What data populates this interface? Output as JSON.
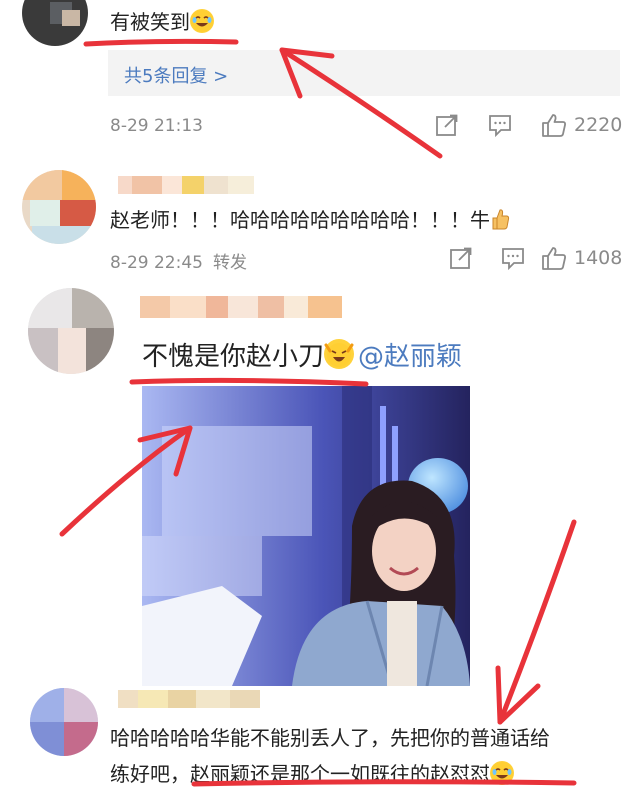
{
  "comment1": {
    "text": "有被笑到",
    "reply_link": "共5条回复 >",
    "time": "8-29 21:13",
    "likes": "2220"
  },
  "comment2": {
    "text": "赵老师！！！哈哈哈哈哈哈哈哈哈！！！牛",
    "time": "8-29 22:45",
    "forward": "转发",
    "likes": "1408"
  },
  "comment3": {
    "text": "不愧是你赵小刀",
    "mention": "@赵丽颖"
  },
  "comment4": {
    "line1": "哈哈哈哈哈华能不能别丢人了，先把你的普通话给",
    "line2_prefix": "练好吧，",
    "line2_underlined": "赵丽颖还是那个一如既往的赵怼怼"
  },
  "colors": {
    "link": "#4c7bbf",
    "annotation": "#e8333a",
    "meta": "#8a8a8a",
    "reply_bg": "#f3f3f3"
  },
  "icons": [
    "share-icon",
    "comment-icon",
    "like-icon"
  ]
}
